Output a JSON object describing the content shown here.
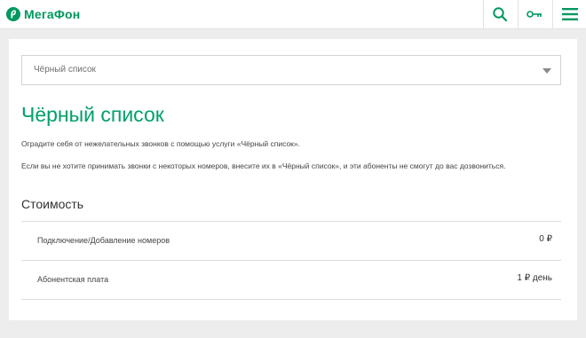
{
  "header": {
    "brand": "МегаФон",
    "brand_color": "#00985f",
    "icons": [
      "search-icon",
      "key-icon",
      "menu-icon"
    ]
  },
  "main": {
    "select": {
      "value": "Чёрный список"
    },
    "title": "Чёрный список",
    "title_color": "#00a06a",
    "description": [
      "Оградите себя от нежелательных звонков с помощью услуги «Чёрный список».",
      "Если вы не хотите принимать звонки с некоторых номеров, внесите их в «Чёрный список», и эти абоненты не смогут до вас дозвониться."
    ],
    "section_title": "Стоимость",
    "price_rows": [
      {
        "label": "Подключение/Добавление номеров",
        "value": "0 ₽"
      },
      {
        "label": "Абонентская плата",
        "value": "1 ₽ день"
      }
    ]
  }
}
